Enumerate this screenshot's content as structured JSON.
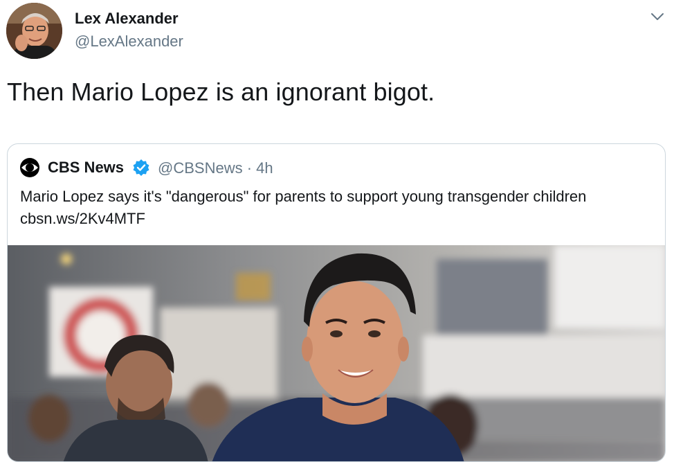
{
  "tweet": {
    "author_name": "Lex Alexander",
    "author_handle": "@LexAlexander",
    "text": "Then Mario Lopez is an ignorant bigot.",
    "menu_icon": "chevron-down-icon"
  },
  "quoted": {
    "name": "CBS News",
    "handle_time": "@CBSNews · 4h",
    "text": "Mario Lopez says it's \"dangerous\" for parents to support young transgender children ",
    "link": "cbsn.ws/2Kv4MTF",
    "verified_color": "#1da1f2",
    "logo_icon": "cbs-eye-logo",
    "verified_icon": "verified-badge-icon"
  },
  "colors": {
    "text": "#14171a",
    "secondary": "#657786",
    "border": "#ccd6dd",
    "accent": "#1da1f2"
  }
}
